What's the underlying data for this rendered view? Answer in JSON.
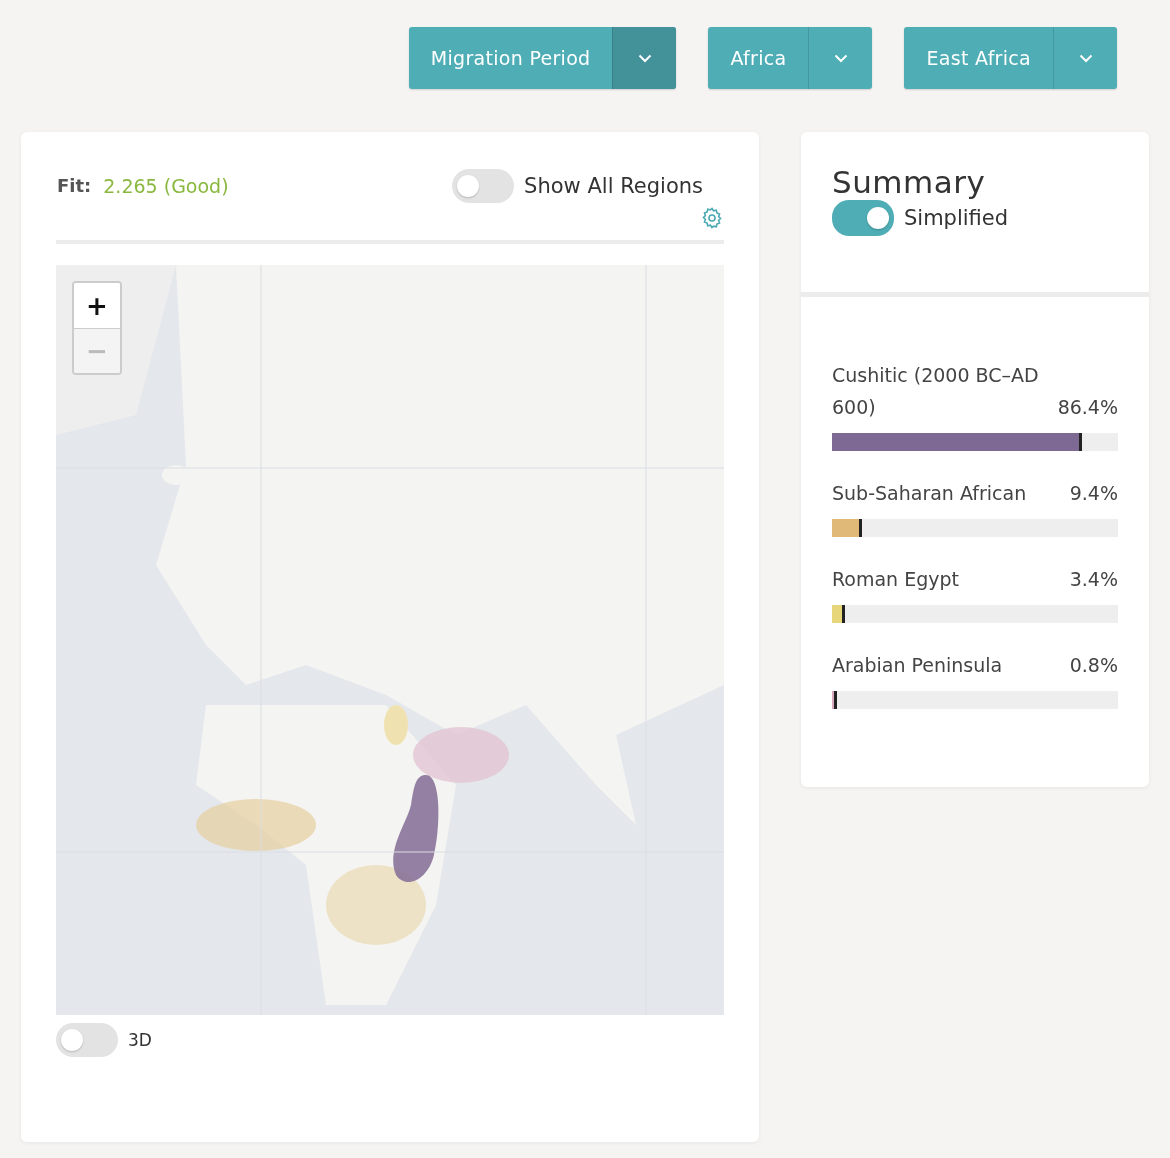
{
  "dropdowns": [
    {
      "label": "Migration Period",
      "selected": true
    },
    {
      "label": "Africa",
      "selected": false
    },
    {
      "label": "East Africa",
      "selected": false
    }
  ],
  "map_panel": {
    "fit": {
      "label": "Fit:",
      "value": "2.265 (Good)"
    },
    "show_all_regions": {
      "label": "Show All Regions",
      "on": false
    },
    "zoom_controls": [
      {
        "label": "+",
        "disabled": false
      },
      {
        "label": "−",
        "disabled": true
      }
    ],
    "toggle_3d": {
      "label": "3D",
      "on": false
    }
  },
  "summary": {
    "title": "Summary",
    "simplified": {
      "label": "Simplified",
      "on": true
    },
    "items": [
      {
        "name": "Cushitic (2000 BC–AD 600)",
        "value": "86.4%",
        "level": 0.864,
        "color": "#7e6894"
      },
      {
        "name": "Sub-Saharan African",
        "value": "9.4%",
        "level": 0.094,
        "color": "#e0b878"
      },
      {
        "name": "Roman Egypt",
        "value": "3.4%",
        "level": 0.034,
        "color": "#e8d67a"
      },
      {
        "name": "Arabian Peninsula",
        "value": "0.8%",
        "level": 0.008,
        "color": "#d9a9c0"
      }
    ]
  }
}
